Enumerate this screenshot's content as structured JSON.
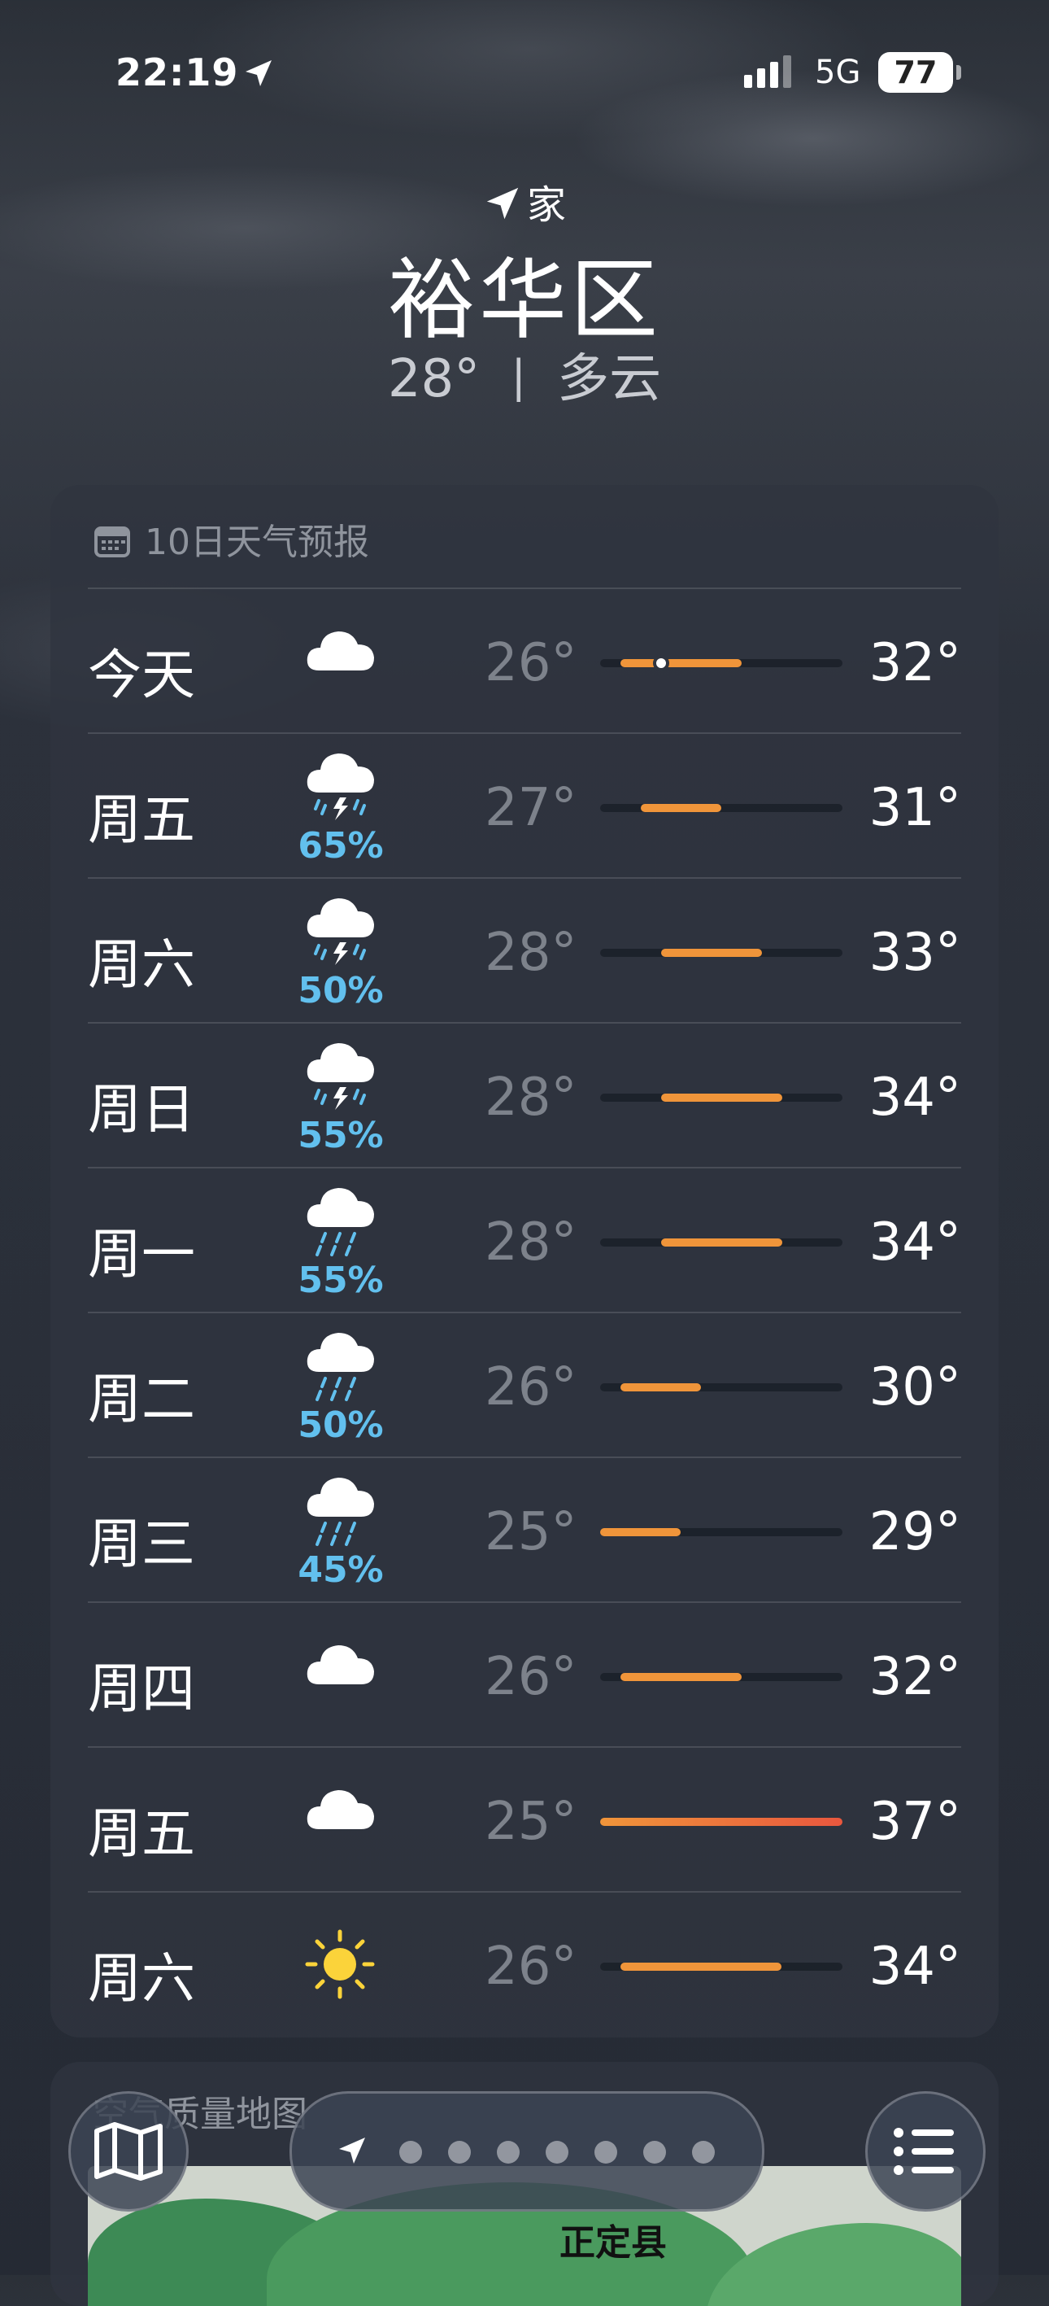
{
  "status": {
    "time": "22:19",
    "network": "5G",
    "battery": "77"
  },
  "header": {
    "home_label": "家",
    "city": "裕华区",
    "current_temp": "28°",
    "condition": "多云",
    "separator": "|"
  },
  "forecast": {
    "title": "10日天气预报",
    "scale_min": 25,
    "scale_max": 37,
    "days": [
      {
        "day": "今天",
        "icon": "cloud-icon",
        "pop": "",
        "low": "26°",
        "high": "32°",
        "low_v": 26,
        "high_v": 32,
        "current_v": 28
      },
      {
        "day": "周五",
        "icon": "thunderstorm-icon",
        "pop": "65%",
        "low": "27°",
        "high": "31°",
        "low_v": 27,
        "high_v": 31
      },
      {
        "day": "周六",
        "icon": "thunderstorm-icon",
        "pop": "50%",
        "low": "28°",
        "high": "33°",
        "low_v": 28,
        "high_v": 33
      },
      {
        "day": "周日",
        "icon": "thunderstorm-icon",
        "pop": "55%",
        "low": "28°",
        "high": "34°",
        "low_v": 28,
        "high_v": 34
      },
      {
        "day": "周一",
        "icon": "rain-icon",
        "pop": "55%",
        "low": "28°",
        "high": "34°",
        "low_v": 28,
        "high_v": 34
      },
      {
        "day": "周二",
        "icon": "rain-icon",
        "pop": "50%",
        "low": "26°",
        "high": "30°",
        "low_v": 26,
        "high_v": 30
      },
      {
        "day": "周三",
        "icon": "rain-icon",
        "pop": "45%",
        "low": "25°",
        "high": "29°",
        "low_v": 25,
        "high_v": 29
      },
      {
        "day": "周四",
        "icon": "cloud-icon",
        "pop": "",
        "low": "26°",
        "high": "32°",
        "low_v": 26,
        "high_v": 32
      },
      {
        "day": "周五",
        "icon": "cloud-icon",
        "pop": "",
        "low": "25°",
        "high": "37°",
        "low_v": 25,
        "high_v": 37
      },
      {
        "day": "周六",
        "icon": "sun-icon",
        "pop": "",
        "low": "26°",
        "high": "34°",
        "low_v": 26,
        "high_v": 34
      }
    ]
  },
  "air_quality": {
    "title": "空气质量地图",
    "place": "正定县"
  },
  "bottom_bar": {
    "map_button": "map-icon",
    "list_button": "list-icon",
    "page_count": 7
  },
  "colors": {
    "bar_warm": "#f0953a",
    "bar_hot": "#e9573e",
    "pop": "#62c0ee"
  }
}
